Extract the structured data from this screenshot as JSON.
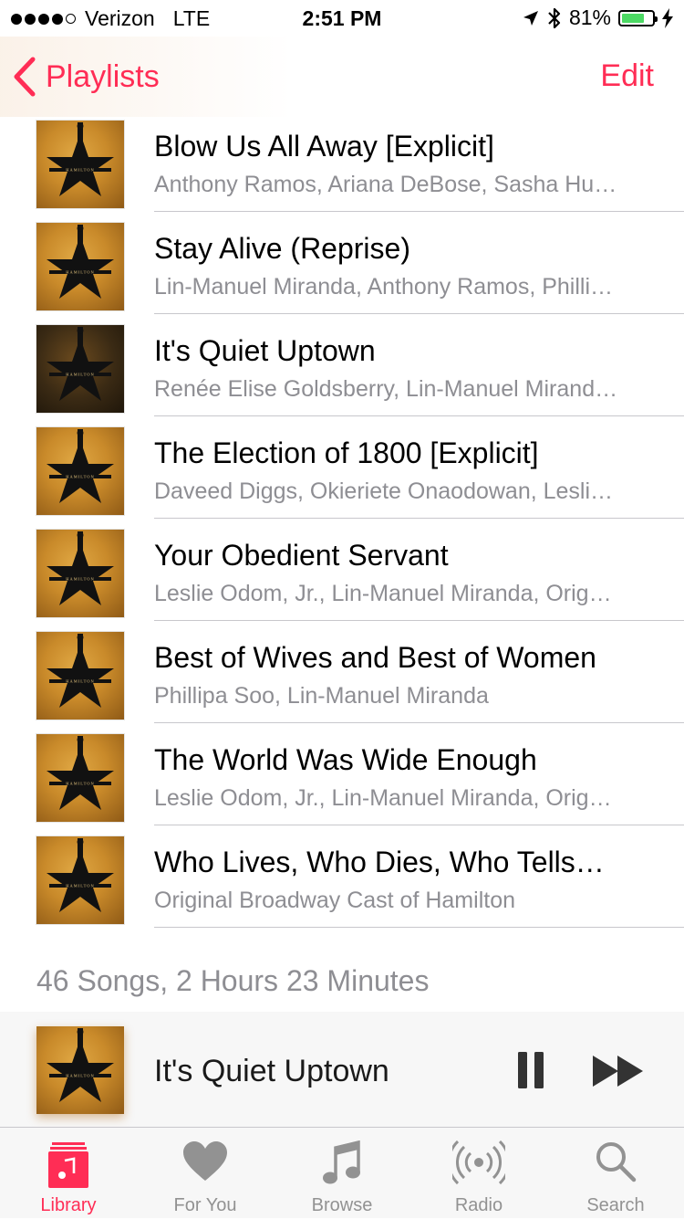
{
  "status_bar": {
    "carrier": "Verizon",
    "network": "LTE",
    "time": "2:51 PM",
    "battery_percent": "81%",
    "battery_level": 0.81,
    "icons": [
      "location-arrow-icon",
      "bluetooth-icon",
      "battery-icon",
      "charging-bolt-icon"
    ]
  },
  "nav": {
    "back_label": "Playlists",
    "edit_label": "Edit"
  },
  "songs": [
    {
      "title": "Blow Us All Away [Explicit]",
      "artist": "Anthony Ramos, Ariana DeBose, Sasha Hu…"
    },
    {
      "title": "Stay Alive (Reprise)",
      "artist": "Lin-Manuel Miranda, Anthony Ramos, Philli…"
    },
    {
      "title": "It's Quiet Uptown",
      "artist": "Renée Elise Goldsberry, Lin-Manuel Mirand…"
    },
    {
      "title": "The Election of 1800 [Explicit]",
      "artist": "Daveed Diggs, Okieriete Onaodowan, Lesli…"
    },
    {
      "title": "Your Obedient Servant",
      "artist": "Leslie Odom, Jr., Lin-Manuel Miranda, Orig…"
    },
    {
      "title": "Best of Wives and Best of Women",
      "artist": "Phillipa Soo, Lin-Manuel Miranda"
    },
    {
      "title": "The World Was Wide Enough",
      "artist": "Leslie Odom, Jr., Lin-Manuel Miranda, Orig…"
    },
    {
      "title": "Who Lives, Who Dies, Who Tells…",
      "artist": "Original Broadway Cast of Hamilton"
    }
  ],
  "summary": "46 Songs, 2 Hours 23 Minutes",
  "now_playing": {
    "title": "It's Quiet Uptown"
  },
  "tabs": [
    {
      "label": "Library",
      "icon": "library-icon",
      "active": true
    },
    {
      "label": "For You",
      "icon": "heart-icon",
      "active": false
    },
    {
      "label": "Browse",
      "icon": "music-note-icon",
      "active": false
    },
    {
      "label": "Radio",
      "icon": "radio-icon",
      "active": false
    },
    {
      "label": "Search",
      "icon": "search-icon",
      "active": false
    }
  ],
  "colors": {
    "accent": "#ff2d55",
    "secondary_text": "#8e8e93",
    "tab_inactive": "#929292"
  }
}
